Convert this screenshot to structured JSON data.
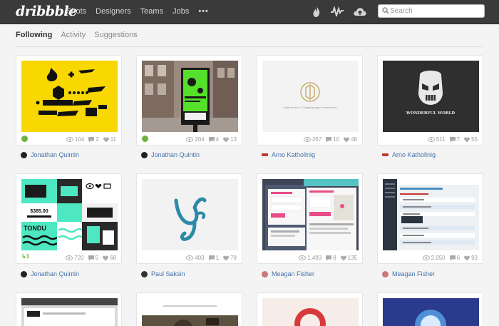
{
  "app": {
    "logo": "dribbble"
  },
  "nav": {
    "items": [
      "Shots",
      "Designers",
      "Teams",
      "Jobs"
    ],
    "more": "•••"
  },
  "search": {
    "placeholder": "Search"
  },
  "tabs": [
    {
      "label": "Following",
      "active": true
    },
    {
      "label": "Activity",
      "active": false
    },
    {
      "label": "Suggestions",
      "active": false
    }
  ],
  "shots": [
    {
      "views": "104",
      "comments": "2",
      "likes": "11",
      "author": "Jonathan Quintin",
      "rebound": ""
    },
    {
      "views": "204",
      "comments": "4",
      "likes": "13",
      "author": "Jonathan Quintin",
      "rebound": ""
    },
    {
      "views": "267",
      "comments": "10",
      "likes": "48",
      "author": "Arno Kathollnig",
      "rebound": "",
      "thumb_caption": "Kastenhuber & Siegelsperger Investments"
    },
    {
      "views": "511",
      "comments": "7",
      "likes": "55",
      "author": "Arno Kathollnig",
      "rebound": "",
      "thumb_caption": "WONDERFUL WORLD"
    },
    {
      "views": "720",
      "comments": "5",
      "likes": "68",
      "author": "Jonathan Quintin",
      "rebound": "1",
      "thumb_price": "$385.00",
      "thumb_word": "TONDU"
    },
    {
      "views": "403",
      "comments": "1",
      "likes": "78",
      "author": "Paul Saksin",
      "rebound": ""
    },
    {
      "views": "1,493",
      "comments": "8",
      "likes": "135",
      "author": "Meagan Fisher",
      "rebound": ""
    },
    {
      "views": "2,050",
      "comments": "6",
      "likes": "93",
      "author": "Meagan Fisher",
      "rebound": ""
    }
  ],
  "colors": {
    "topbar": "#3a3a3a",
    "link": "#4473a8",
    "rebound": "#6fb140",
    "accent_pink": "#ea4c89"
  }
}
